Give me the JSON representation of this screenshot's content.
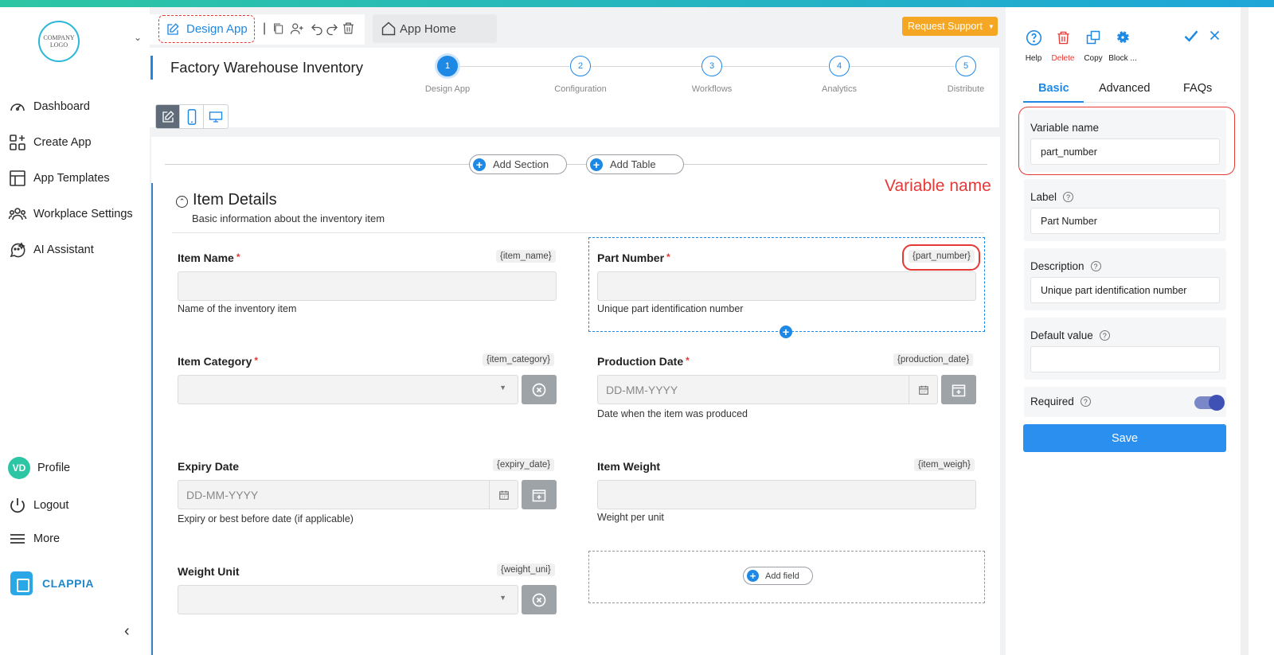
{
  "sidebar": {
    "logo_text": "COMPANY LOGO",
    "items": [
      {
        "label": "Dashboard",
        "icon": "speedometer-icon"
      },
      {
        "label": "Create App",
        "icon": "create-app-icon"
      },
      {
        "label": "App Templates",
        "icon": "templates-icon"
      },
      {
        "label": "Workplace Settings",
        "icon": "users-icon"
      },
      {
        "label": "AI Assistant",
        "icon": "ai-chat-icon"
      }
    ],
    "profile_initials": "VD",
    "profile_label": "Profile",
    "logout_label": "Logout",
    "more_label": "More",
    "brand": "CLAPPIA"
  },
  "topbar": {
    "design_tab": "Design App",
    "app_home": "App Home",
    "request_support": "Request Support"
  },
  "app": {
    "title": "Factory Warehouse Inventory",
    "steps": [
      {
        "num": "1",
        "label": "Design App",
        "active": true
      },
      {
        "num": "2",
        "label": "Configuration",
        "active": false
      },
      {
        "num": "3",
        "label": "Workflows",
        "active": false
      },
      {
        "num": "4",
        "label": "Analytics",
        "active": false
      },
      {
        "num": "5",
        "label": "Distribute",
        "active": false
      }
    ]
  },
  "canvas": {
    "add_section": "Add Section",
    "add_table": "Add Table",
    "annotation": "Variable name",
    "section_title": "Item Details",
    "section_subtitle": "Basic information about the inventory item",
    "add_field": "Add field",
    "fields": {
      "item_name": {
        "label": "Item Name",
        "tag": "{item_name}",
        "help": "Name of the inventory item"
      },
      "part_number": {
        "label": "Part Number",
        "tag": "{part_number}",
        "help": "Unique part identification number"
      },
      "item_category": {
        "label": "Item Category",
        "tag": "{item_category}"
      },
      "production_date": {
        "label": "Production Date",
        "tag": "{production_date}",
        "placeholder": "DD-MM-YYYY",
        "help": "Date when the item was produced"
      },
      "expiry_date": {
        "label": "Expiry Date",
        "tag": "{expiry_date}",
        "placeholder": "DD-MM-YYYY",
        "help": "Expiry or best before date (if applicable)"
      },
      "item_weight": {
        "label": "Item Weight",
        "tag": "{item_weigh}",
        "help": "Weight per unit"
      },
      "weight_unit": {
        "label": "Weight Unit",
        "tag": "{weight_uni}"
      }
    },
    "required_mark": "*"
  },
  "panel": {
    "tools": [
      "Help",
      "Delete",
      "Copy",
      "Block ..."
    ],
    "tabs": [
      "Basic",
      "Advanced",
      "FAQs"
    ],
    "variable_name_label": "Variable name",
    "variable_name_value": "part_number",
    "label_label": "Label",
    "label_value": "Part Number",
    "description_label": "Description",
    "description_value": "Unique part identification number",
    "default_label": "Default value",
    "default_value": "",
    "required_label": "Required",
    "required_on": true,
    "save_label": "Save"
  },
  "colors": {
    "accent": "#1e88e5",
    "danger": "#e53935",
    "support": "#f5a623",
    "brand": "#2dc6a4"
  }
}
